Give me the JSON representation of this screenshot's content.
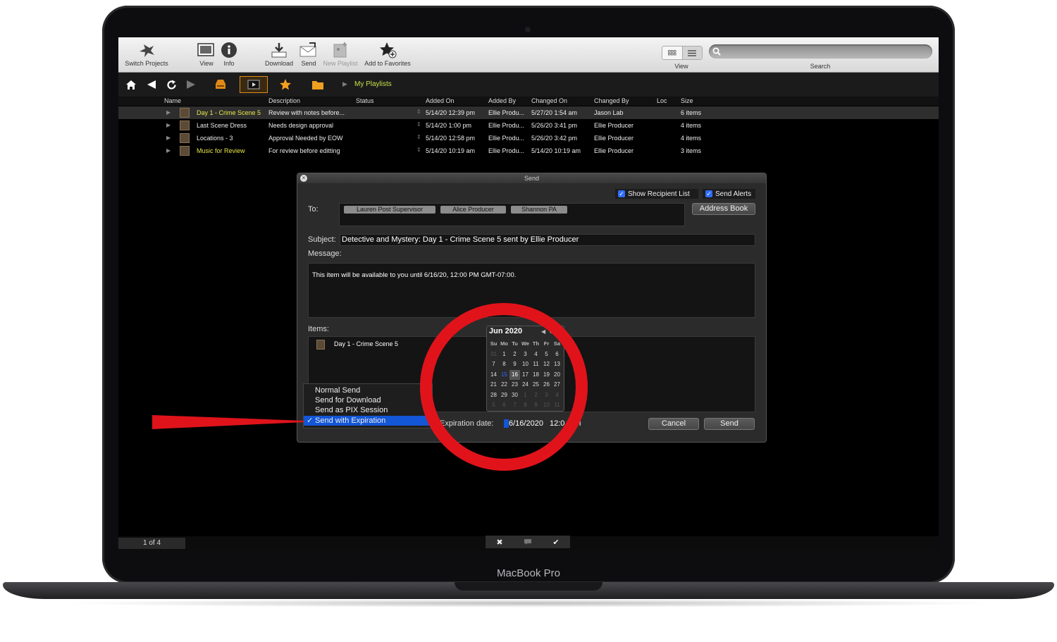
{
  "device": {
    "brand": "MacBook Pro"
  },
  "toolbar": {
    "switch_projects": "Switch Projects",
    "view": "View",
    "info": "Info",
    "download": "Download",
    "send": "Send",
    "new_playlist": "New Playlist",
    "add_to_favorites": "Add to Favorites",
    "view_right": "View",
    "search": "Search"
  },
  "navbar": {
    "breadcrumb": "My Playlists"
  },
  "table": {
    "columns": [
      "Name",
      "Description",
      "Status",
      "Added On",
      "Added By",
      "Changed On",
      "Changed By",
      "Loc",
      "Size"
    ],
    "rows": [
      {
        "name": "Day 1 - Crime Scene 5",
        "description": "Review with notes before...",
        "added_on": "5/14/20 12:39 pm",
        "added_by": "Ellie Produ...",
        "changed_on": "5/27/20 1:54 am",
        "changed_by": "Jason Lab",
        "size": "6 items"
      },
      {
        "name": "Last Scene Dress",
        "description": "Needs design approval",
        "added_on": "5/14/20 1:00 pm",
        "added_by": "Ellie Produ...",
        "changed_on": "5/26/20 3:41 pm",
        "changed_by": "Ellie Producer",
        "size": "4 items"
      },
      {
        "name": "Locations - 3",
        "description": "Approval Needed by EOW",
        "added_on": "5/14/20 12:58 pm",
        "added_by": "Ellie Produ...",
        "changed_on": "5/26/20 3:42 pm",
        "changed_by": "Ellie Producer",
        "size": "4 items"
      },
      {
        "name": "Music for Review",
        "description": "For review before editting",
        "added_on": "5/14/20 10:19 am",
        "added_by": "Ellie Produ...",
        "changed_on": "5/14/20 10:19 am",
        "changed_by": "Ellie Producer",
        "size": "3 items"
      }
    ],
    "highlight_color": "#e8e84a"
  },
  "dialog": {
    "title": "Send",
    "show_recipient_list": "Show Recipient List",
    "send_alerts": "Send Alerts",
    "to_label": "To:",
    "recipients": [
      "Lauren Post Supervisor",
      "Alice Producer",
      "Shannon PA"
    ],
    "address_book": "Address Book",
    "subject_label": "Subject:",
    "subject_value": "Detective and Mystery: Day 1 - Crime Scene 5 sent by Ellie Producer",
    "message_label": "Message:",
    "message_value": "This item will be available to you until 6/16/20, 12:00 PM GMT-07:00.",
    "items_label": "Items:",
    "item_name": "Day 1 - Crime Scene 5",
    "expiration_label": "Expiration date:",
    "expiration_date": "6/16/2020",
    "expiration_time": "12:0",
    "expiration_suffix": "M",
    "cancel": "Cancel",
    "send": "Send"
  },
  "send_menu": {
    "options": [
      "Normal Send",
      "Send for Download",
      "Send as PIX Session",
      "Send with Expiration"
    ],
    "selected": "Send with Expiration",
    "check": "✓"
  },
  "calendar": {
    "month": "Jun 2020",
    "weekdays": [
      "Su",
      "Mo",
      "Tu",
      "We",
      "Th",
      "Fr",
      "Sa"
    ],
    "days": [
      "31",
      "1",
      "2",
      "3",
      "4",
      "5",
      "6",
      "7",
      "8",
      "9",
      "10",
      "11",
      "12",
      "13",
      "14",
      "15",
      "16",
      "17",
      "18",
      "19",
      "20",
      "21",
      "22",
      "23",
      "24",
      "25",
      "26",
      "27",
      "28",
      "29",
      "30",
      "1",
      "2",
      "3",
      "4",
      "5",
      "6",
      "7",
      "8",
      "9",
      "10",
      "11"
    ]
  },
  "status": {
    "pager": "1 of 4"
  },
  "annotation_color": "#e0131b"
}
